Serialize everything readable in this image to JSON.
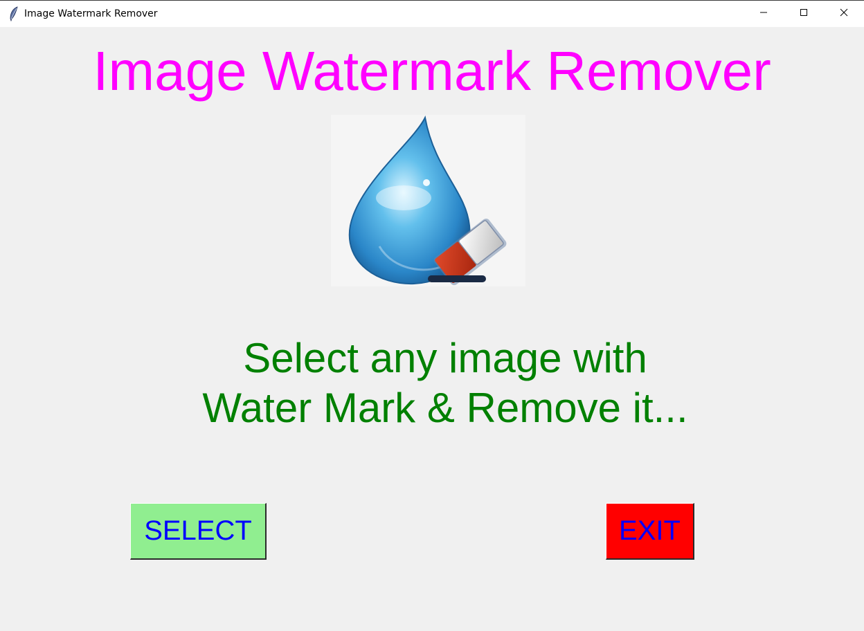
{
  "window": {
    "title": "Image Watermark Remover",
    "controls": {
      "minimize": "minimize-icon",
      "maximize": "maximize-icon",
      "close": "close-icon"
    }
  },
  "main": {
    "heading": "Image Watermark Remover",
    "logo_icon": "water-drop-eraser-icon",
    "message_line1": "Select any image with",
    "message_line2": "Water Mark & Remove it...",
    "select_label": "SELECT",
    "exit_label": "EXIT"
  },
  "colors": {
    "heading": "#ff00ff",
    "message": "#008000",
    "button_text": "#0000ff",
    "select_bg": "#90ee90",
    "exit_bg": "#ff0000",
    "window_bg": "#f0f0f0"
  }
}
